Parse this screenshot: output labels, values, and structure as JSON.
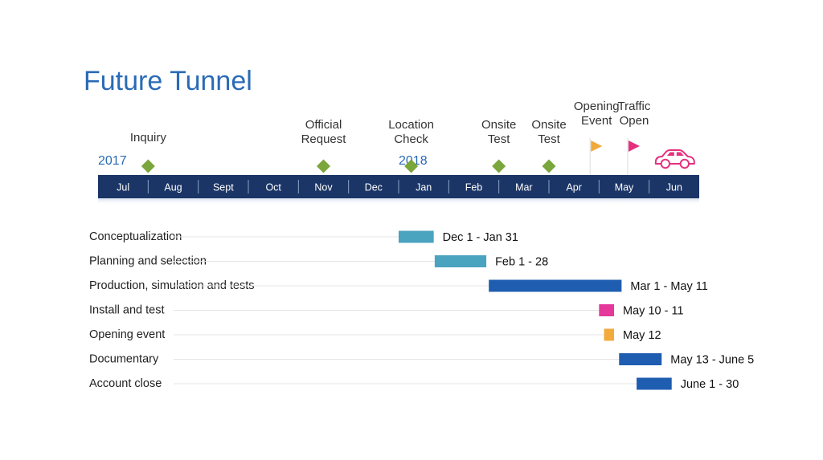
{
  "chart_data": {
    "type": "gantt",
    "title": "Future Tunnel",
    "years": [
      {
        "label": "2017",
        "month_index": 0
      },
      {
        "label": "2018",
        "month_index": 6
      }
    ],
    "months": [
      "Jul",
      "Aug",
      "Sept",
      "Oct",
      "Nov",
      "Dec",
      "Jan",
      "Feb",
      "Mar",
      "Apr",
      "May",
      "Jun"
    ],
    "milestones": [
      {
        "lines": [
          "Inquiry"
        ],
        "month_index": 1,
        "marker": "diamond",
        "color": "#7aa63c",
        "label_color": "#333333"
      },
      {
        "lines": [
          "Official",
          "Request"
        ],
        "month_index": 4.5,
        "marker": "diamond",
        "color": "#7aa63c",
        "label_color": "#333333"
      },
      {
        "lines": [
          "Location",
          "Check"
        ],
        "month_index": 6.25,
        "marker": "diamond",
        "color": "#7aa63c",
        "label_color": "#333333"
      },
      {
        "lines": [
          "Onsite",
          "Test"
        ],
        "month_index": 8,
        "marker": "diamond",
        "color": "#7aa63c",
        "label_color": "#333333"
      },
      {
        "lines": [
          "Onsite",
          "Test"
        ],
        "month_index": 9,
        "marker": "diamond",
        "color": "#7aa63c",
        "label_color": "#333333"
      },
      {
        "lines": [
          "Opening",
          "Event"
        ],
        "month_index": 9.95,
        "marker": "flag",
        "color": "#f0a93b",
        "label_color": "#ef8a1c"
      },
      {
        "lines": [
          "Traffic",
          "Open"
        ],
        "month_index": 10.7,
        "marker": "flag",
        "color": "#e5307f",
        "label_color": "#e5307f"
      }
    ],
    "car_icon": {
      "name": "car-icon",
      "month_index": 11.5,
      "color": "#e5307f"
    },
    "tasks": [
      {
        "name": "Conceptualization",
        "start": 6.0,
        "end": 6.7,
        "range_label": "Dec 1 - Jan 31",
        "color": "#4aa3bf"
      },
      {
        "name": "Planning and selection",
        "start": 6.72,
        "end": 7.75,
        "range_label": "Feb 1 - 28",
        "color": "#4aa3bf"
      },
      {
        "name": "Production, simulation and tests",
        "start": 7.8,
        "end": 10.45,
        "range_label": "Mar 1 - May 11",
        "color": "#1f5db0"
      },
      {
        "name": "Install and test",
        "start": 10.0,
        "end": 10.3,
        "range_label": "May 10 - 11",
        "color": "#e5389a"
      },
      {
        "name": "Opening event",
        "start": 10.1,
        "end": 10.3,
        "range_label": "May 12",
        "color": "#f3aa3c"
      },
      {
        "name": "Documentary",
        "start": 10.4,
        "end": 11.25,
        "range_label": "May 13 - June 5",
        "color": "#1f5db0"
      },
      {
        "name": "Account close",
        "start": 10.75,
        "end": 11.45,
        "range_label": "June 1 - 30",
        "color": "#1f5db0"
      }
    ],
    "colors": {
      "title": "#2a6bb6",
      "year": "#2a6bb6",
      "timeline_band": "#1b3566",
      "divider": "#8ea3c7",
      "task_guide": "#e4e4e4",
      "text": "#222222"
    }
  }
}
